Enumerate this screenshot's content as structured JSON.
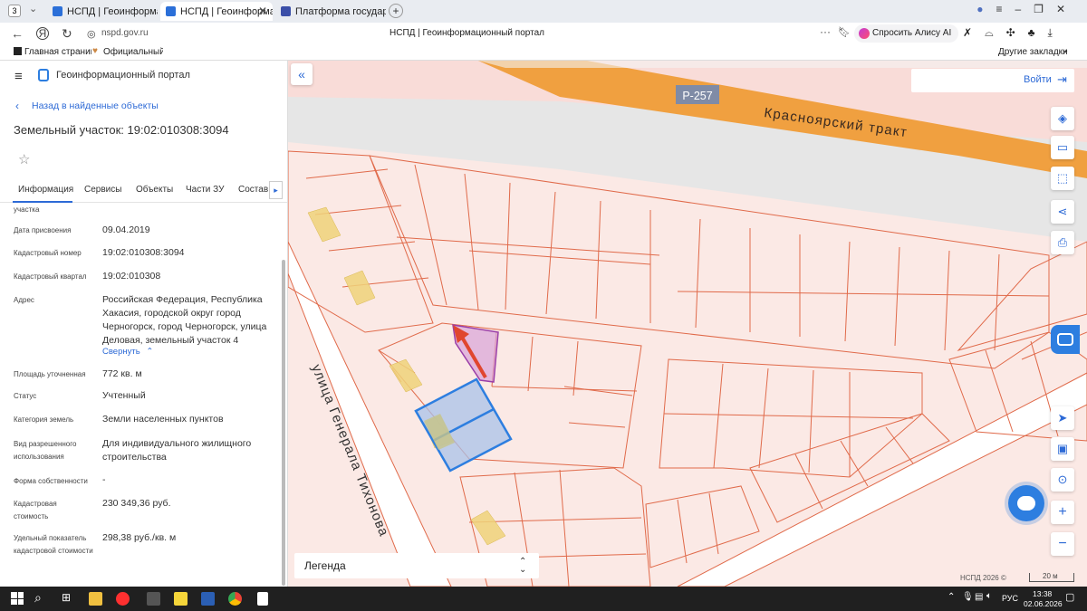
{
  "browser": {
    "tab_count": "3",
    "tabs": [
      {
        "title": "НСПД | Геоинформацио"
      },
      {
        "title": "НСПД | Геоинформаци"
      },
      {
        "title": "Платформа государствен"
      }
    ],
    "url": "nspd.gov.ru",
    "page_title": "НСПД | Геоинформационный портал",
    "alice_label": "Спросить Алису AI",
    "bookmarks": [
      {
        "label": "Главная страница"
      },
      {
        "label": "Официальный са"
      }
    ],
    "other_bookmarks": "Другие закладки"
  },
  "sidebar": {
    "portal_title": "Геоинформационный портал",
    "back_link": "Назад в найденные объекты",
    "object_title": "Земельный участок: 19:02:010308:3094",
    "tabs": [
      {
        "label": "Информация"
      },
      {
        "label": "Сервисы"
      },
      {
        "label": "Объекты"
      },
      {
        "label": "Части ЗУ"
      },
      {
        "label": "Состав"
      }
    ],
    "cut_label": "участка",
    "properties": [
      {
        "label": "Дата присвоения",
        "value": "09.04.2019"
      },
      {
        "label": "Кадастровый номер",
        "value": "19:02:010308:3094"
      },
      {
        "label": "Кадастровый квартал",
        "value": "19:02:010308"
      },
      {
        "label": "Адрес",
        "value": "Российская Федерация, Республика Хакасия, городской округ город Черногорск, город Черногорск, улица Деловая, земельный участок 4"
      },
      {
        "label": "Площадь уточненная",
        "value": "772 кв. м"
      },
      {
        "label": "Статус",
        "value": "Учтенный"
      },
      {
        "label": "Категория земель",
        "value": "Земли населенных пунктов"
      },
      {
        "label": "Вид разрешенного использования",
        "value": "Для индивидуального жилищного строительства"
      },
      {
        "label": "Форма собственности",
        "value": "-"
      },
      {
        "label": "Кадастровая стоимость",
        "value": "230 349,36 руб."
      },
      {
        "label": "Удельный показатель кадастровой стоимости",
        "value": "298,38 руб./кв. м"
      }
    ],
    "collapse_link": "Свернуть"
  },
  "map": {
    "login_label": "Войти",
    "road_badge": "Р-257",
    "road_name": "Красноярский тракт",
    "street_name": "улица Генерала Тихонова",
    "legend_label": "Легенда",
    "copyright": "НСПД 2026 ©",
    "scale_label": "20 м",
    "colors": {
      "parcel_fill": "#fbe9e5",
      "parcel_line": "#e06a4a",
      "road": "#f0a040",
      "selected": "#2d7ee0",
      "highlight": "#9b3fa8"
    }
  },
  "taskbar": {
    "language": "РУС",
    "time": "13:38",
    "date": "02.06.2026"
  }
}
